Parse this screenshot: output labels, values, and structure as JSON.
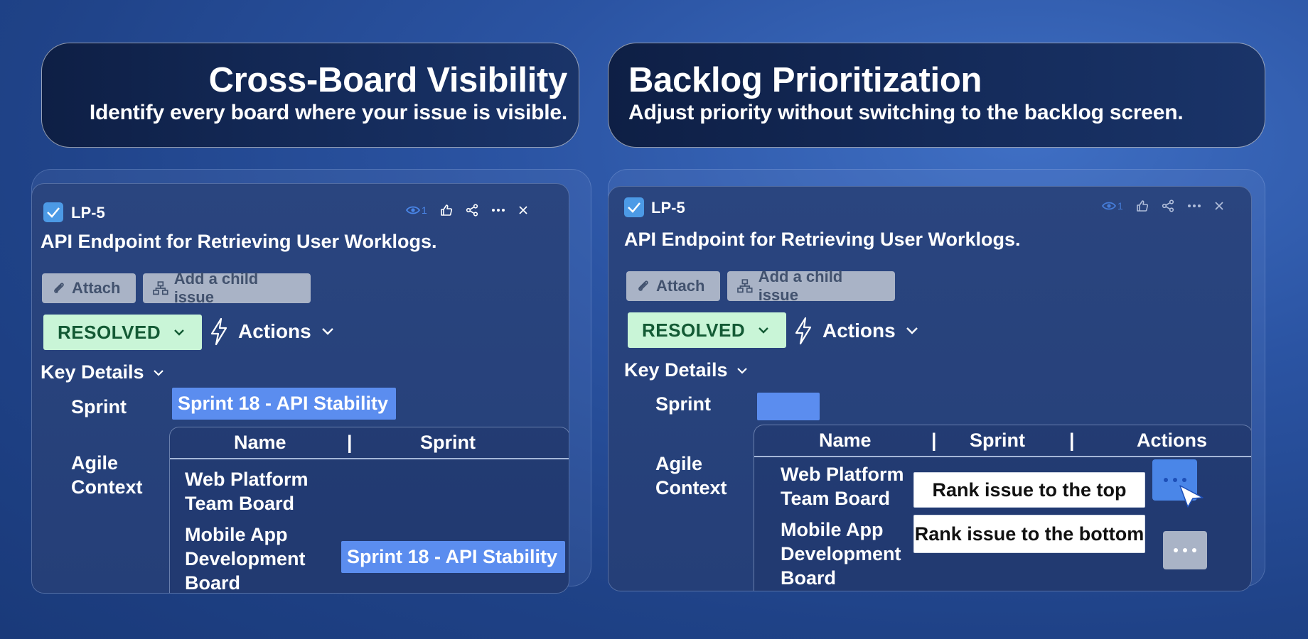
{
  "left_header": {
    "title": "Cross-Board Visibility",
    "subtitle": "Identify every board where your issue is visible."
  },
  "right_header": {
    "title": "Backlog Prioritization",
    "subtitle": "Adjust priority without switching to the backlog screen."
  },
  "issue": {
    "key": "LP-5",
    "watch_count": "1",
    "title": "API Endpoint for Retrieving User Worklogs.",
    "attach_label": "Attach",
    "add_child_label": "Add a child issue",
    "status_label": "RESOLVED",
    "actions_label": "Actions",
    "key_details_label": "Key Details",
    "sprint_label": "Sprint",
    "sprint_value": "Sprint 18 - API Stability",
    "agile_context_label": "Agile\nContext"
  },
  "left_table": {
    "headers": [
      "Name",
      "|",
      "Sprint"
    ],
    "rows": [
      {
        "name": "Web Platform\nTeam Board",
        "sprint": ""
      },
      {
        "name": "Mobile App\nDevelopment\nBoard",
        "sprint": "Sprint 18 - API Stability"
      }
    ]
  },
  "right_table": {
    "headers": [
      "Name",
      "|",
      "Sprint",
      "|",
      "Actions"
    ],
    "rows": [
      {
        "name": "Web Platform\nTeam Board"
      },
      {
        "name": "Mobile App\nDevelopment\nBoard"
      }
    ],
    "menu": {
      "rank_top": "Rank issue to the top",
      "rank_bottom": "Rank issue to the bottom"
    }
  },
  "colors": {
    "accent_blue": "#5b8def",
    "status_green_bg": "#c9f5d7",
    "status_green_text": "#135a34",
    "gray_button": "#a9b3c6"
  },
  "icons": [
    "check-icon",
    "eye-icon",
    "thumbs-up-icon",
    "share-icon",
    "more-icon",
    "close-icon",
    "paperclip-icon",
    "hierarchy-icon",
    "chevron-down-icon",
    "lightning-icon",
    "cursor-icon"
  ]
}
